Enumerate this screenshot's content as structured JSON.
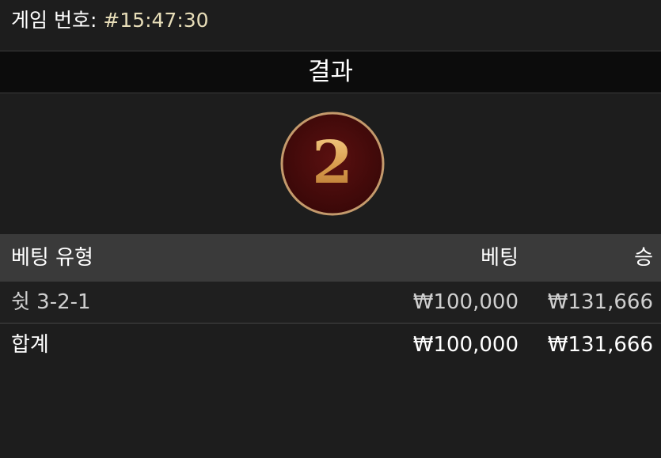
{
  "header": {
    "game_number_label": "게임 번호: ",
    "game_number_value": "#15:47:30"
  },
  "result": {
    "title": "결과",
    "number": "2"
  },
  "table": {
    "columns": {
      "bet_type": "베팅 유형",
      "bet": "베팅",
      "win": "승"
    },
    "rows": [
      {
        "bet_type": "쉿 3-2-1",
        "bet": "₩100,000",
        "win": "₩131,666"
      }
    ],
    "total": {
      "label": "합계",
      "bet": "₩100,000",
      "win": "₩131,666"
    }
  },
  "colors": {
    "background": "#1d1d1d",
    "result_bar": "#0c0c0c",
    "table_header": "#3a3a3a",
    "medal_fill": "#4a0c0c",
    "medal_ring": "#c49a6c",
    "medal_digit": "#e0b26a",
    "game_number_value": "#e7ddb8"
  }
}
